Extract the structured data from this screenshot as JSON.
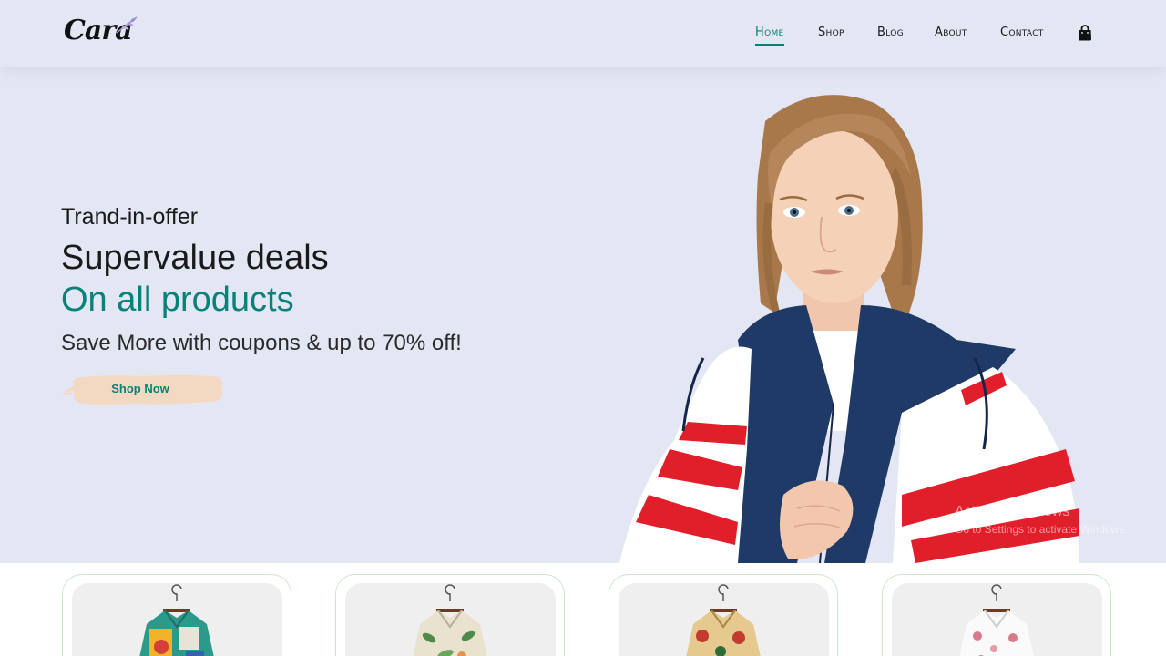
{
  "header": {
    "logo_text": "Cara",
    "nav": [
      {
        "label": "Home",
        "active": true
      },
      {
        "label": "Shop",
        "active": false
      },
      {
        "label": "Blog",
        "active": false
      },
      {
        "label": "About",
        "active": false
      },
      {
        "label": "Contact",
        "active": false
      }
    ],
    "cart_icon": "shopping-bag-icon"
  },
  "hero": {
    "tagline": "Trand-in-offer",
    "title": "Supervalue deals",
    "highlight": "On all products",
    "subtitle": "Save More with coupons & up to 70% off!",
    "button_label": "Shop Now"
  },
  "watermark": {
    "line1": "Activate Windows",
    "line2": "Go to Settings to activate Windows."
  },
  "colors": {
    "accent": "#088178",
    "hero_bg": "#e3e6f3",
    "button_brush": "#f3d9c1"
  },
  "products": [
    {
      "image": "shirt-patterned-multicolor"
    },
    {
      "image": "shirt-floral-green"
    },
    {
      "image": "shirt-floral-red"
    },
    {
      "image": "shirt-floral-white"
    }
  ]
}
